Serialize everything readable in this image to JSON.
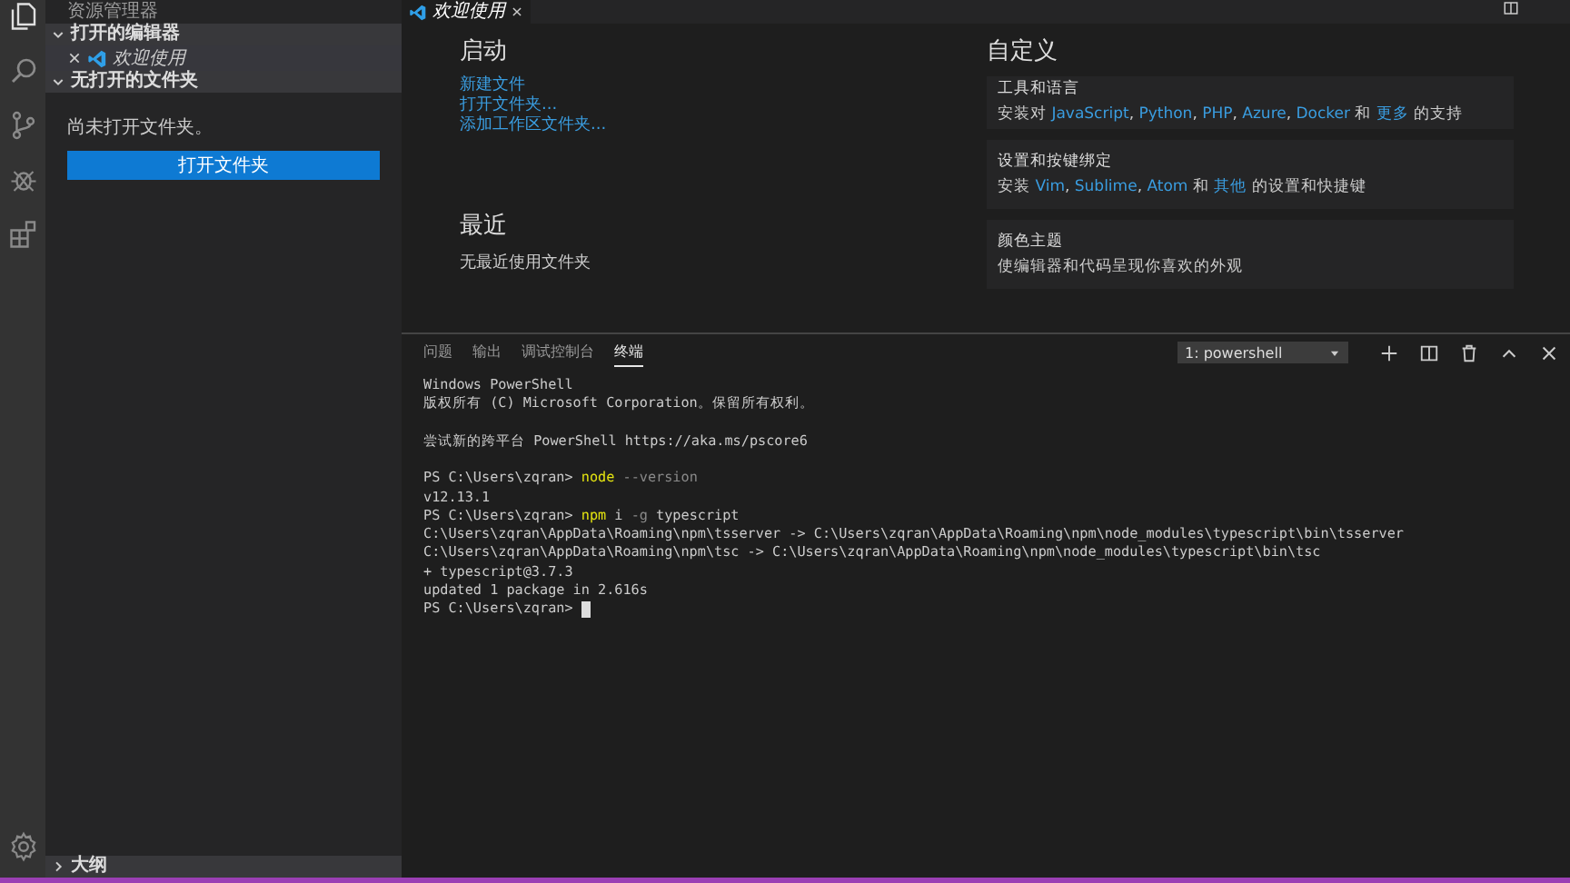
{
  "activity_bar": {
    "items": [
      {
        "kind": "files",
        "selected": true
      },
      {
        "kind": "search",
        "selected": false
      },
      {
        "kind": "scm",
        "selected": false
      },
      {
        "kind": "debug",
        "selected": false
      },
      {
        "kind": "extensions",
        "selected": false
      }
    ],
    "bottom": {
      "kind": "settings"
    }
  },
  "sidebar": {
    "title": "资源管理器",
    "sections": [
      {
        "title": "打开的编辑器",
        "expanded": true,
        "items": [
          {
            "label": "欢迎使用",
            "italic": true
          }
        ]
      },
      {
        "title": "无打开的文件夹",
        "expanded": true,
        "message": "尚未打开文件夹。",
        "button": "打开文件夹"
      },
      {
        "title": "大纲",
        "expanded": false
      }
    ]
  },
  "editor_tabs": [
    {
      "label": "欢迎使用",
      "selected": true
    }
  ],
  "welcome": {
    "start": {
      "title": "启动",
      "links": [
        "新建文件",
        "打开文件夹...",
        "添加工作区文件夹..."
      ]
    },
    "recent": {
      "title": "最近",
      "message": "无最近使用文件夹"
    },
    "customize": {
      "title": "自定义",
      "cards": [
        {
          "title": "工具和语言",
          "description": [
            {
              "text": "安装对 ",
              "link": false
            },
            {
              "text": "JavaScript",
              "link": true,
              "suffix": ", "
            },
            {
              "text": "Python",
              "link": true,
              "suffix": ", "
            },
            {
              "text": "PHP",
              "link": true,
              "suffix": ", "
            },
            {
              "text": "Azure",
              "link": true,
              "suffix": ", "
            },
            {
              "text": "Docker",
              "link": true,
              "suffix": " 和 "
            },
            {
              "text": "更多",
              "link": true
            },
            {
              "text": " 的支持",
              "link": false
            }
          ]
        },
        {
          "title": "设置和按键绑定",
          "description": [
            {
              "text": "安装 ",
              "link": false
            },
            {
              "text": "Vim",
              "link": true,
              "suffix": ", "
            },
            {
              "text": "Sublime",
              "link": true,
              "suffix": ", "
            },
            {
              "text": "Atom",
              "link": true,
              "suffix": " 和 "
            },
            {
              "text": "其他",
              "link": true
            },
            {
              "text": " 的设置和快捷键",
              "link": false
            }
          ]
        },
        {
          "title": "颜色主题",
          "description": [
            {
              "text": "使编辑器和代码呈现你喜欢的外观",
              "link": false
            }
          ]
        }
      ]
    }
  },
  "panel": {
    "tabs": [
      {
        "label": "问题",
        "selected": false
      },
      {
        "label": "输出",
        "selected": false
      },
      {
        "label": "调试控制台",
        "selected": false
      },
      {
        "label": "终端",
        "selected": true
      }
    ],
    "terminal_select": "1: powershell",
    "terminal": [
      {
        "kind": "text",
        "segments": [
          {
            "text": "Windows PowerShell",
            "kind": "plain"
          }
        ]
      },
      {
        "kind": "text",
        "segments": [
          {
            "text": "版权所有 (C) Microsoft Corporation。保留所有权利。",
            "kind": "plain"
          }
        ]
      },
      {
        "kind": "blank"
      },
      {
        "kind": "text",
        "segments": [
          {
            "text": "尝试新的跨平台 PowerShell https://aka.ms/pscore6",
            "kind": "plain"
          }
        ]
      },
      {
        "kind": "blank"
      },
      {
        "kind": "text",
        "segments": [
          {
            "text": "PS C:\\Users\\zqran> ",
            "kind": "plain"
          },
          {
            "text": "node",
            "kind": "command"
          },
          {
            "text": " --version",
            "kind": "flag"
          }
        ]
      },
      {
        "kind": "text",
        "segments": [
          {
            "text": "v12.13.1",
            "kind": "plain"
          }
        ]
      },
      {
        "kind": "text",
        "segments": [
          {
            "text": "PS C:\\Users\\zqran> ",
            "kind": "plain"
          },
          {
            "text": "npm",
            "kind": "command"
          },
          {
            "text": " i",
            "kind": "plain"
          },
          {
            "text": " -g",
            "kind": "flag"
          },
          {
            "text": " typescript",
            "kind": "plain"
          }
        ]
      },
      {
        "kind": "text",
        "segments": [
          {
            "text": "C:\\Users\\zqran\\AppData\\Roaming\\npm\\tsserver -> C:\\Users\\zqran\\AppData\\Roaming\\npm\\node_modules\\typescript\\bin\\tsserver",
            "kind": "plain"
          }
        ]
      },
      {
        "kind": "text",
        "segments": [
          {
            "text": "C:\\Users\\zqran\\AppData\\Roaming\\npm\\tsc -> C:\\Users\\zqran\\AppData\\Roaming\\npm\\node_modules\\typescript\\bin\\tsc",
            "kind": "plain"
          }
        ]
      },
      {
        "kind": "text",
        "segments": [
          {
            "text": "+ typescript@3.7.3",
            "kind": "plain"
          }
        ]
      },
      {
        "kind": "text",
        "segments": [
          {
            "text": "updated 1 package in 2.616s",
            "kind": "plain"
          }
        ]
      },
      {
        "kind": "text",
        "segments": [
          {
            "text": "PS C:\\Users\\zqran> ",
            "kind": "plain"
          }
        ],
        "cursor": true
      }
    ]
  }
}
